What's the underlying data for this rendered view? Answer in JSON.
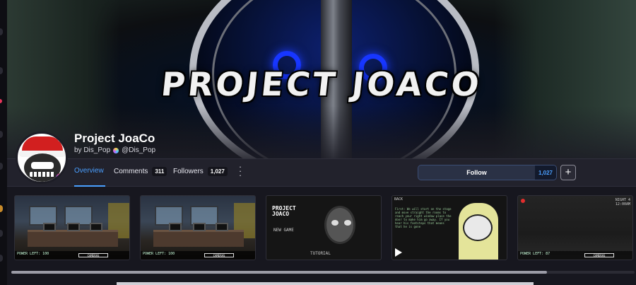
{
  "banner": {
    "logo_text": "PROJECT JOACO"
  },
  "game": {
    "title": "Project JoaCo",
    "by_label": "by Dis_Pop",
    "handle": "@Dis_Pop"
  },
  "nav": {
    "tabs": [
      {
        "label": "Overview",
        "active": true
      },
      {
        "label": "Comments",
        "count": "311"
      },
      {
        "label": "Followers",
        "count": "1,027"
      }
    ],
    "more_icon": "vertical-ellipsis-icon",
    "follow_label": "Follow",
    "follow_count": "1,027",
    "add_icon": "plus-icon",
    "plus_label": "+"
  },
  "gallery": {
    "shots": [
      {
        "kind": "office",
        "hud": "POWER LEFT: 100",
        "cam_label": "CAMERAS"
      },
      {
        "kind": "office",
        "hud": "POWER LEFT: 100",
        "cam_label": "CAMERAS"
      },
      {
        "kind": "menu",
        "title_line1": "PROJECT",
        "title_line2": "JOACO",
        "new_game": "NEW GAME",
        "tutorial": "TUTORIAL"
      },
      {
        "kind": "tutorial",
        "back": "BACK",
        "text": "First: We will start on the stage and move straight the rooms to reach your right window place the door to make him go away. If you hear his footsteps that means that he is gone",
        "play_icon": "play-icon"
      },
      {
        "kind": "dark",
        "night": "NIGHT 4",
        "time": "12:00AM",
        "hud": "POWER LEFT: 87",
        "cam_label": "CAMERAS"
      }
    ]
  },
  "colors": {
    "accent": "#4a9fff",
    "background": "#1d1d26",
    "follow_bg": "#2a3145"
  }
}
